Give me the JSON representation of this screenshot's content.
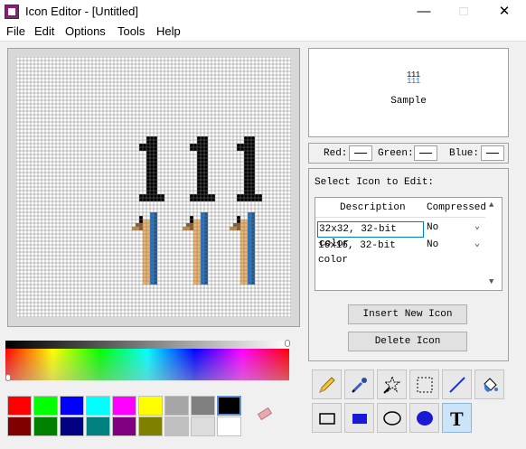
{
  "window": {
    "title": "Icon Editor - [Untitled]"
  },
  "menu": {
    "file": "File",
    "edit": "Edit",
    "options": "Options",
    "tools": "Tools",
    "help": "Help"
  },
  "preview": {
    "icon_text": "111",
    "label": "Sample"
  },
  "color_readout": {
    "red_label": "Red:",
    "green_label": "Green:",
    "blue_label": "Blue:"
  },
  "icon_select": {
    "title": "Select Icon to Edit:",
    "columns": [
      "Description",
      "Compressed"
    ],
    "rows": [
      {
        "description": "32x32, 32-bit color",
        "compressed": "No",
        "selected": true
      },
      {
        "description": "16x16, 32-bit color",
        "compressed": "No",
        "selected": false
      }
    ],
    "insert_button": "Insert New Icon",
    "delete_button": "Delete Icon"
  },
  "palette": {
    "row1": [
      "#ff0000",
      "#00ff00",
      "#0000ff",
      "#00ffff",
      "#ff00ff",
      "#ffff00",
      "#a6a6a6",
      "#808080",
      "#000000"
    ],
    "row2": [
      "#800000",
      "#008000",
      "#000080",
      "#008080",
      "#800080",
      "#808000",
      "#c0c0c0",
      "#dcdcdc",
      "#ffffff"
    ],
    "selected": "#000000"
  },
  "tools": [
    {
      "icon": "pencil-icon"
    },
    {
      "icon": "eyedropper-icon"
    },
    {
      "icon": "magic-wand-icon"
    },
    {
      "icon": "selection-rect-icon"
    },
    {
      "icon": "line-icon"
    },
    {
      "icon": "paint-bucket-icon"
    },
    {
      "icon": "rectangle-outline-icon"
    },
    {
      "icon": "rectangle-filled-icon"
    },
    {
      "icon": "ellipse-outline-icon"
    },
    {
      "icon": "ellipse-filled-icon"
    },
    {
      "icon": "text-tool-icon"
    }
  ],
  "active_tool": "text-tool-icon"
}
